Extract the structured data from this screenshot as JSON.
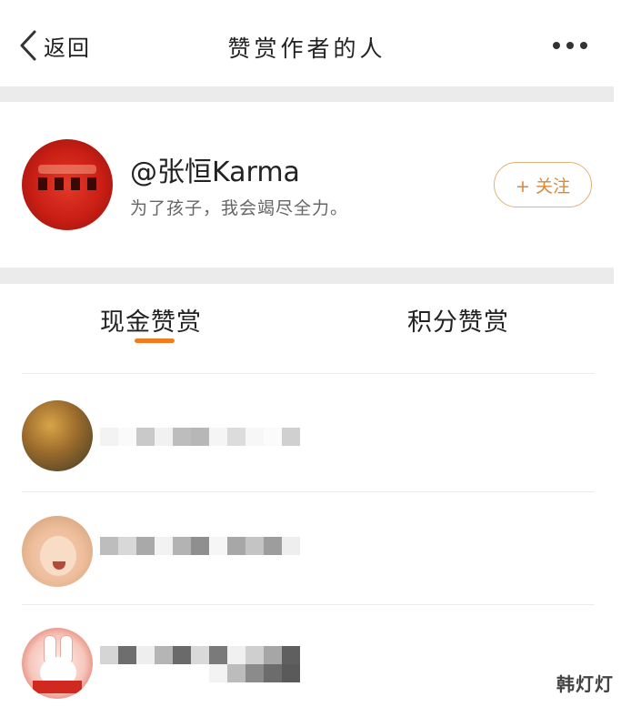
{
  "nav": {
    "back_label": "返回",
    "title": "赞赏作者的人",
    "more_icon": "more-icon"
  },
  "author": {
    "name": "@张恒Karma",
    "bio": "为了孩子，我会竭尽全力。",
    "follow_label": "+ 关注"
  },
  "tabs": [
    {
      "label": "现金赞赏",
      "active": true
    },
    {
      "label": "积分赞赏",
      "active": false
    }
  ],
  "colors": {
    "accent": "#ef7d1e",
    "follow_border": "#e0b277",
    "follow_text": "#d7893a",
    "section_gap": "#ebebeb"
  },
  "watermark": "韩灯灯"
}
